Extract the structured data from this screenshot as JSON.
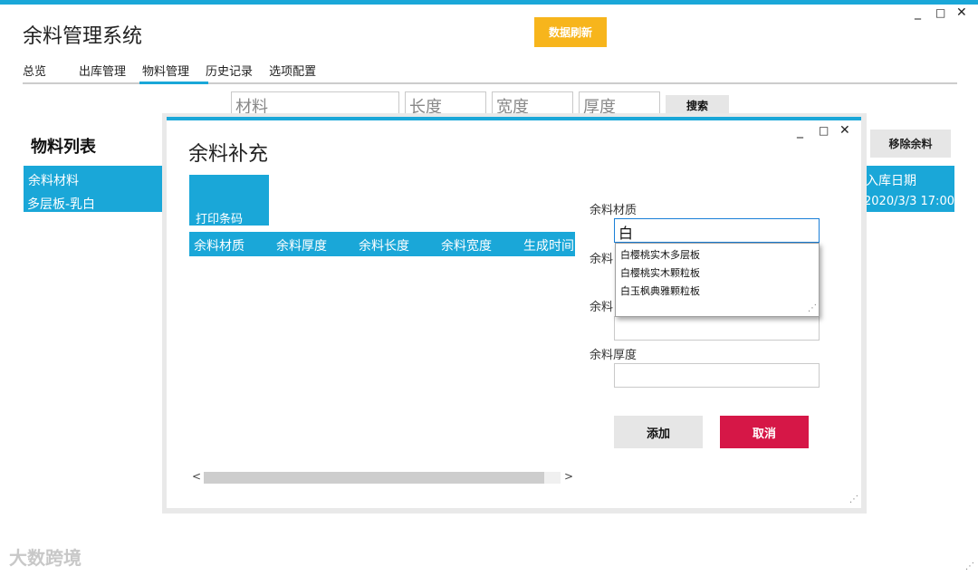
{
  "app": {
    "title": "余料管理系统",
    "refresh_label": "数据刷新",
    "minimize": "_",
    "maximize": "□",
    "close": "✕"
  },
  "nav": {
    "tabs": [
      {
        "label": "总览"
      },
      {
        "label": "出库管理"
      },
      {
        "label": "物料管理"
      },
      {
        "label": "历史记录"
      },
      {
        "label": "选项配置"
      }
    ],
    "active": "物料管理"
  },
  "search": {
    "material_placeholder": "材料",
    "length_placeholder": "长度",
    "width_placeholder": "宽度",
    "thickness_placeholder": "厚度",
    "search_label": "搜索"
  },
  "list": {
    "title": "物料列表",
    "remove_label": "移除余料",
    "col_material": "余料材料",
    "row_material": "多层板-乳白",
    "col_date": "入库日期",
    "row_date": "2020/3/3 17:00"
  },
  "dialog": {
    "title": "余料补充",
    "print_label": "打印条码",
    "minimize": "_",
    "maximize": "□",
    "close": "✕",
    "columns": [
      "余料材质",
      "余料厚度",
      "余料长度",
      "余料宽度",
      "生成时间"
    ],
    "scroll_left": "<",
    "scroll_right": ">",
    "form": {
      "material_label": "余料材质",
      "material_value": "白",
      "second_label_partial": "余料",
      "third_label_partial": "余料",
      "thickness_label": "余料厚度",
      "suggestions": [
        "白樱桃实木多层板",
        "白樱桃实木颗粒板",
        "白玉枫典雅颗粒板"
      ]
    },
    "add_label": "添加",
    "cancel_label": "取消"
  },
  "watermark": "大数跨境",
  "colors": {
    "accent": "#1aa7d8",
    "refresh": "#f7b51c",
    "cancel": "#d61747"
  }
}
